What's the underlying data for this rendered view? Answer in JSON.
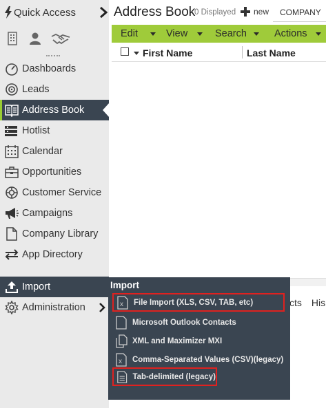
{
  "sidebar": {
    "quick_access_label": "Quick Access",
    "nav": [
      {
        "label": "Dashboards",
        "icon": "dashboard-gauge-icon"
      },
      {
        "label": "Leads",
        "icon": "leads-target-icon"
      },
      {
        "label": "Address Book",
        "icon": "address-book-icon",
        "active": true
      },
      {
        "label": "Hotlist",
        "icon": "hotlist-icon"
      },
      {
        "label": "Calendar",
        "icon": "calendar-icon"
      },
      {
        "label": "Opportunities",
        "icon": "opportunities-icon"
      },
      {
        "label": "Customer Service",
        "icon": "lifebuoy-icon"
      },
      {
        "label": "Campaigns",
        "icon": "megaphone-icon"
      },
      {
        "label": "Company Library",
        "icon": "document-icon"
      },
      {
        "label": "App Directory",
        "icon": "arrows-exchange-icon"
      }
    ],
    "import_label": "Import",
    "administration_label": "Administration"
  },
  "header": {
    "title": "Address Book",
    "count": "0 Displayed",
    "new_label": "new",
    "company_tab": "COMPANY"
  },
  "toolbar": {
    "edit": "Edit",
    "view": "View",
    "search": "Search",
    "actions": "Actions"
  },
  "grid": {
    "col1": "First Name",
    "col2": "Last Name"
  },
  "lower_tabs": [
    "cts",
    "His"
  ],
  "import_menu": {
    "title": "Import",
    "items": [
      {
        "label": "File Import (XLS, CSV, TAB, etc)",
        "icon": "excel-file-icon",
        "highlighted": true
      },
      {
        "label": "Microsoft Outlook Contacts",
        "icon": "blank-file-icon",
        "highlighted": false
      },
      {
        "label": "XML and Maximizer MXI",
        "icon": "copy-files-icon",
        "highlighted": false
      },
      {
        "label": "Comma-Separated Values (CSV)(legacy)",
        "icon": "excel-file-icon",
        "highlighted": false
      },
      {
        "label": "Tab-delimited (legacy)",
        "icon": "text-file-icon",
        "highlighted": true
      }
    ]
  },
  "colors": {
    "toolbar_green": "#9fcb3a",
    "dark_panel": "#3a4551",
    "highlight_red": "#e0211f",
    "sidebar_bg": "#eaeaea"
  }
}
